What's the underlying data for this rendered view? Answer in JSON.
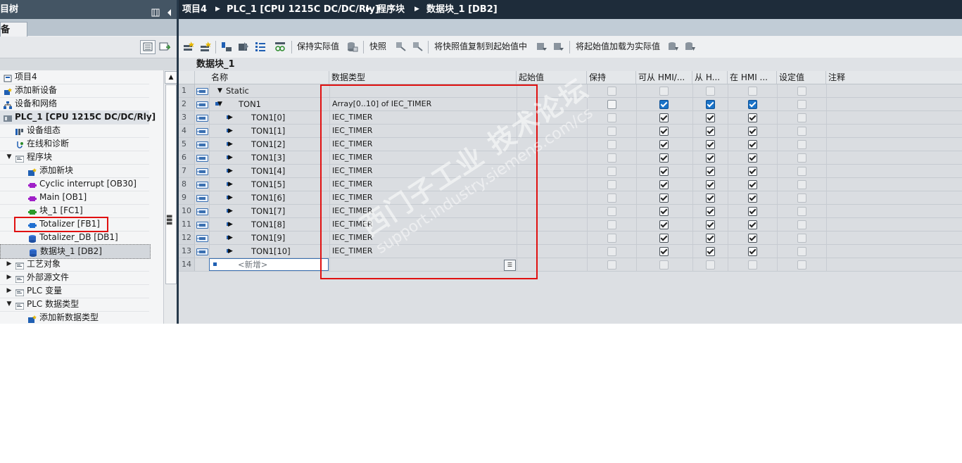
{
  "left_panel": {
    "title": "目树",
    "tab": "备",
    "tree": [
      {
        "label": "项目4",
        "icon": "project-icon",
        "level": 0,
        "arrow": "none",
        "bold": false
      },
      {
        "label": "添加新设备",
        "icon": "add-device-icon",
        "level": 0,
        "arrow": "none",
        "bold": false
      },
      {
        "label": "设备和网络",
        "icon": "network-icon",
        "level": 0,
        "arrow": "none",
        "bold": false
      },
      {
        "label": "PLC_1 [CPU 1215C DC/DC/Rly]",
        "icon": "plc-icon",
        "level": 0,
        "arrow": "none",
        "bold": true
      },
      {
        "label": "设备组态",
        "icon": "device-config-icon",
        "level": 1,
        "arrow": "none",
        "bold": false
      },
      {
        "label": "在线和诊断",
        "icon": "diagnostics-icon",
        "level": 1,
        "arrow": "none",
        "bold": false
      },
      {
        "label": "程序块",
        "icon": "folder-icon",
        "level": 1,
        "arrow": "down",
        "bold": false
      },
      {
        "label": "添加新块",
        "icon": "add-block-icon",
        "level": 2,
        "arrow": "none",
        "bold": false
      },
      {
        "label": "Cyclic interrupt [OB30]",
        "icon": "ob-icon",
        "level": 2,
        "arrow": "none",
        "bold": false
      },
      {
        "label": "Main [OB1]",
        "icon": "ob-icon",
        "level": 2,
        "arrow": "none",
        "bold": false
      },
      {
        "label": "块_1 [FC1]",
        "icon": "fc-icon",
        "level": 2,
        "arrow": "none",
        "bold": false
      },
      {
        "label": "Totalizer [FB1]",
        "icon": "fb-icon",
        "level": 2,
        "arrow": "none",
        "bold": false
      },
      {
        "label": "Totalizer_DB [DB1]",
        "icon": "db-icon",
        "level": 2,
        "arrow": "none",
        "bold": false
      },
      {
        "label": "数据块_1 [DB2]",
        "icon": "db-icon",
        "level": 2,
        "arrow": "none",
        "bold": false
      },
      {
        "label": "工艺对象",
        "icon": "folder-icon",
        "level": 1,
        "arrow": "right",
        "bold": false
      },
      {
        "label": "外部源文件",
        "icon": "folder-icon",
        "level": 1,
        "arrow": "right",
        "bold": false
      },
      {
        "label": "PLC 变量",
        "icon": "folder-icon",
        "level": 1,
        "arrow": "right",
        "bold": false
      },
      {
        "label": "PLC 数据类型",
        "icon": "folder-icon",
        "level": 1,
        "arrow": "down",
        "bold": false
      },
      {
        "label": "添加新数据类型",
        "icon": "add-type-icon",
        "level": 2,
        "arrow": "none",
        "bold": false
      }
    ]
  },
  "breadcrumb": [
    "项目4",
    "PLC_1 [CPU 1215C DC/DC/Rly]",
    "程序块",
    "数据块_1 [DB2]"
  ],
  "toolbar": {
    "keep_actual": "保持实际值",
    "snapshot": "快照",
    "copy_snapshot": "将快照值复制到起始值中",
    "load_start": "将起始值加载为实际值"
  },
  "block_title": "数据块_1",
  "table": {
    "headers": [
      "名称",
      "数据类型",
      "起始值",
      "保持",
      "可从 HMI/...",
      "从 H...",
      "在 HMI ...",
      "设定值",
      "注释"
    ],
    "rows": [
      {
        "num": "1",
        "name": "Static",
        "type": "",
        "level": 0,
        "arrow": "down",
        "hmi": false,
        "from_h": false,
        "in_hmi": false,
        "retain_state": "disabled",
        "blue": false
      },
      {
        "num": "2",
        "name": "TON1",
        "type": "Array[0..10] of IEC_TIMER",
        "level": 1,
        "arrow": "down",
        "hmi": true,
        "from_h": true,
        "in_hmi": true,
        "retain_state": "enabled",
        "blue": true
      },
      {
        "num": "3",
        "name": "TON1[0]",
        "type": "IEC_TIMER",
        "level": 2,
        "arrow": "right",
        "hmi": true,
        "from_h": true,
        "in_hmi": true,
        "retain_state": "disabled",
        "blue": false
      },
      {
        "num": "4",
        "name": "TON1[1]",
        "type": "IEC_TIMER",
        "level": 2,
        "arrow": "right",
        "hmi": true,
        "from_h": true,
        "in_hmi": true,
        "retain_state": "disabled",
        "blue": false
      },
      {
        "num": "5",
        "name": "TON1[2]",
        "type": "IEC_TIMER",
        "level": 2,
        "arrow": "right",
        "hmi": true,
        "from_h": true,
        "in_hmi": true,
        "retain_state": "disabled",
        "blue": false
      },
      {
        "num": "6",
        "name": "TON1[3]",
        "type": "IEC_TIMER",
        "level": 2,
        "arrow": "right",
        "hmi": true,
        "from_h": true,
        "in_hmi": true,
        "retain_state": "disabled",
        "blue": false
      },
      {
        "num": "7",
        "name": "TON1[4]",
        "type": "IEC_TIMER",
        "level": 2,
        "arrow": "right",
        "hmi": true,
        "from_h": true,
        "in_hmi": true,
        "retain_state": "disabled",
        "blue": false
      },
      {
        "num": "8",
        "name": "TON1[5]",
        "type": "IEC_TIMER",
        "level": 2,
        "arrow": "right",
        "hmi": true,
        "from_h": true,
        "in_hmi": true,
        "retain_state": "disabled",
        "blue": false
      },
      {
        "num": "9",
        "name": "TON1[6]",
        "type": "IEC_TIMER",
        "level": 2,
        "arrow": "right",
        "hmi": true,
        "from_h": true,
        "in_hmi": true,
        "retain_state": "disabled",
        "blue": false
      },
      {
        "num": "10",
        "name": "TON1[7]",
        "type": "IEC_TIMER",
        "level": 2,
        "arrow": "right",
        "hmi": true,
        "from_h": true,
        "in_hmi": true,
        "retain_state": "disabled",
        "blue": false
      },
      {
        "num": "11",
        "name": "TON1[8]",
        "type": "IEC_TIMER",
        "level": 2,
        "arrow": "right",
        "hmi": true,
        "from_h": true,
        "in_hmi": true,
        "retain_state": "disabled",
        "blue": false
      },
      {
        "num": "12",
        "name": "TON1[9]",
        "type": "IEC_TIMER",
        "level": 2,
        "arrow": "right",
        "hmi": true,
        "from_h": true,
        "in_hmi": true,
        "retain_state": "disabled",
        "blue": false
      },
      {
        "num": "13",
        "name": "TON1[10]",
        "type": "IEC_TIMER",
        "level": 2,
        "arrow": "right",
        "hmi": true,
        "from_h": true,
        "in_hmi": true,
        "retain_state": "disabled",
        "blue": false
      }
    ],
    "new_row": {
      "num": "14",
      "placeholder": "<新增>"
    }
  },
  "watermark": {
    "line1": "西门子工业  技术论坛",
    "line2": "support.industry.siemens.com/cs"
  },
  "colors": {
    "accent_blue": "#1a73c8",
    "highlight_red": "#e01010",
    "title_bar": "#1e2c3a"
  }
}
